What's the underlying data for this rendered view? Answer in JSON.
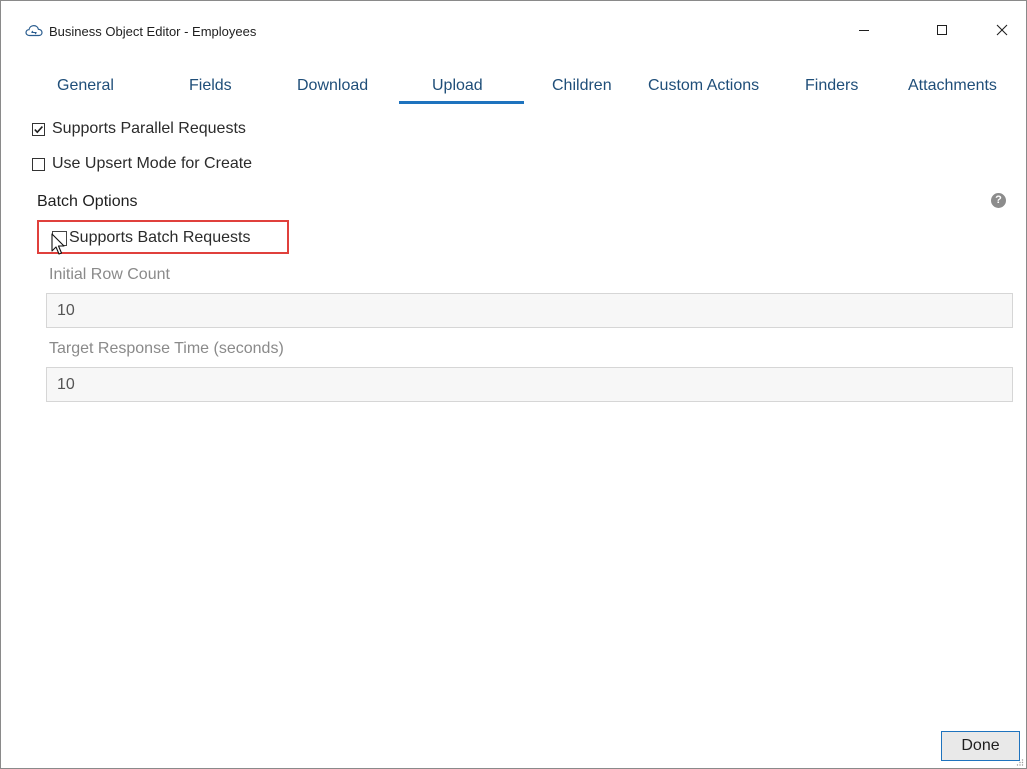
{
  "window": {
    "title": "Business Object Editor - Employees",
    "minimize_glyph": "—",
    "maximize_glyph": "☐",
    "close_glyph": "✕"
  },
  "tabs": [
    {
      "label": "General",
      "active": false
    },
    {
      "label": "Fields",
      "active": false
    },
    {
      "label": "Download",
      "active": false
    },
    {
      "label": "Upload",
      "active": true
    },
    {
      "label": "Children",
      "active": false
    },
    {
      "label": "Custom Actions",
      "active": false
    },
    {
      "label": "Finders",
      "active": false
    },
    {
      "label": "Attachments",
      "active": false
    }
  ],
  "upload": {
    "supports_parallel_requests": {
      "label": "Supports Parallel Requests",
      "checked": true
    },
    "use_upsert_mode": {
      "label": "Use Upsert Mode for Create",
      "checked": false
    },
    "batch_options": {
      "heading": "Batch Options",
      "help_glyph": "?",
      "supports_batch_requests": {
        "label": "Supports Batch Requests",
        "checked": false
      },
      "initial_row_count": {
        "label": "Initial Row Count",
        "value": "10"
      },
      "target_response_time": {
        "label": "Target Response Time (seconds)",
        "value": "10"
      }
    }
  },
  "footer": {
    "done_label": "Done"
  },
  "colors": {
    "tab_text": "#1f4e79",
    "tab_active_underline": "#1e73be",
    "highlight": "#e0403c",
    "disabled_text": "#8a8a8a"
  }
}
